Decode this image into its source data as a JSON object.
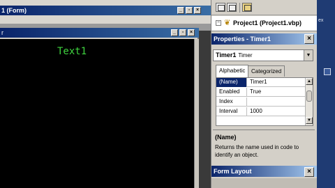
{
  "mdi": {
    "title": "1 (Form)",
    "controls": [
      "_",
      "▫",
      "×"
    ]
  },
  "form": {
    "title": "r",
    "controls": [
      "_",
      "▫",
      "×"
    ],
    "label_text": "Text1"
  },
  "project": {
    "toolbar_icons": [
      "view-code-icon",
      "view-object-icon",
      "toggle-folders-icon"
    ],
    "tree_item": "Project1 (Project1.vbp)",
    "expander": "−"
  },
  "properties": {
    "title": "Properties - Timer1",
    "close": "×",
    "object_name": "Timer1",
    "object_type": "Timer",
    "tabs": [
      "Alphabetic",
      "Categorized"
    ],
    "rows": [
      {
        "name": "(Name)",
        "value": "Timer1"
      },
      {
        "name": "Enabled",
        "value": "True"
      },
      {
        "name": "Index",
        "value": ""
      },
      {
        "name": "Interval",
        "value": "1000"
      }
    ],
    "description_title": "(Name)",
    "description_text": "Returns the name used in code to identify an object."
  },
  "form_layout": {
    "title": "Form Layout",
    "close": "×"
  },
  "background": {
    "text": "ex"
  }
}
